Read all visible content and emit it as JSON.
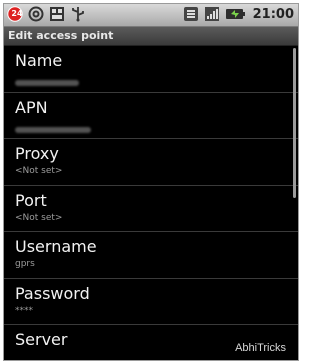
{
  "status_bar": {
    "notification_badge": "24",
    "time": "21:00",
    "icons": [
      "notification-badge-icon",
      "at-sign-icon",
      "usb-debug-icon",
      "usb-icon",
      "wifi-icon",
      "signal-icon",
      "battery-icon"
    ]
  },
  "title": "Edit access point",
  "items": [
    {
      "title": "Name",
      "summary": ""
    },
    {
      "title": "APN",
      "summary": ""
    },
    {
      "title": "Proxy",
      "summary": "<Not set>"
    },
    {
      "title": "Port",
      "summary": "<Not set>"
    },
    {
      "title": "Username",
      "summary": "gprs"
    },
    {
      "title": "Password",
      "summary": "****"
    },
    {
      "title": "Server",
      "summary": ""
    }
  ],
  "watermark": "AbhiTricks",
  "colors": {
    "background": "#000000",
    "title_text": "#f2f2f2",
    "summary_text": "#9c9c9c",
    "header_bg": "#4a4a4a"
  }
}
